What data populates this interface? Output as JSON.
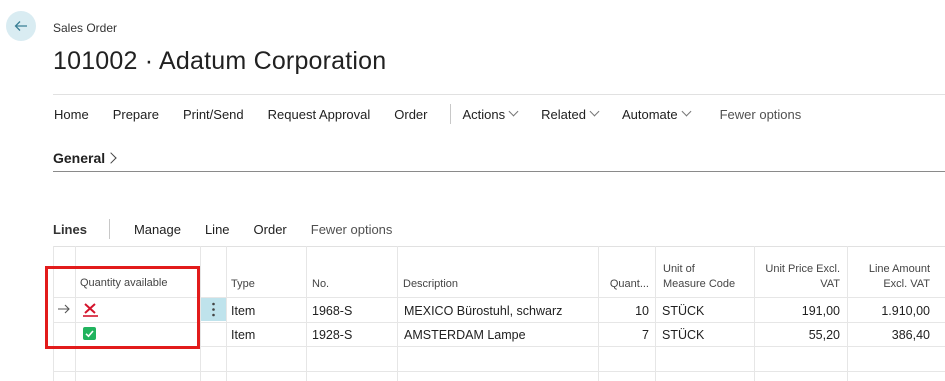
{
  "header": {
    "breadcrumb": "Sales Order",
    "title": "101002 · Adatum Corporation"
  },
  "actionbar": {
    "items": [
      "Home",
      "Prepare",
      "Print/Send",
      "Request Approval",
      "Order"
    ],
    "menus": [
      "Actions",
      "Related",
      "Automate"
    ],
    "fewer_options": "Fewer options"
  },
  "general": {
    "label": "General"
  },
  "lines": {
    "title": "Lines",
    "actions": [
      "Manage",
      "Line",
      "Order"
    ],
    "fewer_options": "Fewer options"
  },
  "table": {
    "headers": {
      "qty_available": "Quantity available",
      "type": "Type",
      "no": "No.",
      "description": "Description",
      "quantity": "Quant...",
      "uom_1": "Unit of",
      "uom_2": "Measure Code",
      "unit_price_1": "Unit Price Excl.",
      "unit_price_2": "VAT",
      "line_amount_1": "Line Amount",
      "line_amount_2": "Excl. VAT"
    },
    "rows": [
      {
        "availability": "not-available",
        "type": "Item",
        "no": "1968-S",
        "description": "MEXICO Bürostuhl, schwarz",
        "quantity": "10",
        "uom": "STÜCK",
        "unit_price": "191,00",
        "line_amount": "1.910,00"
      },
      {
        "availability": "available",
        "type": "Item",
        "no": "1928-S",
        "description": "AMSTERDAM Lampe",
        "quantity": "7",
        "uom": "STÜCK",
        "unit_price": "55,20",
        "line_amount": "386,40"
      }
    ]
  },
  "colors": {
    "accent_bg": "#d9ecf2",
    "highlight_border": "#e21b1b",
    "available_green": "#21b35e",
    "unavailable_red": "#d4142c"
  }
}
